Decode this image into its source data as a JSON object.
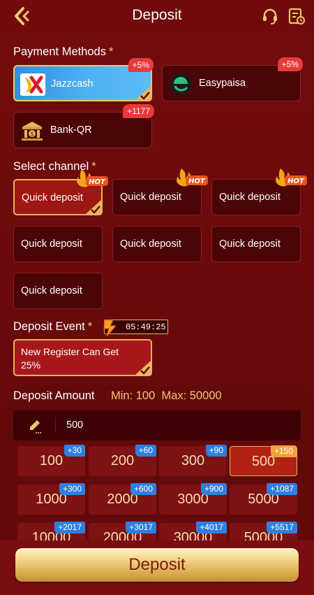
{
  "header": {
    "title": "Deposit",
    "back_icon": "back-arrow-icon",
    "support_icon": "headset-icon",
    "record_icon": "record-icon"
  },
  "colors": {
    "primary_bg": "#700a0c",
    "accent_gold": "#f1c86f",
    "badge_red": "#e83a3a",
    "badge_blue": "#2f7fe0",
    "badge_orange": "#f0a23a"
  },
  "payment": {
    "label": "Payment Methods",
    "required": "*",
    "methods": [
      {
        "name": "Jazzcash",
        "bonus": "+5%",
        "selected": true
      },
      {
        "name": "Easypaisa",
        "bonus": "+5%",
        "selected": false
      },
      {
        "name": "Bank-QR",
        "bonus": "+1177",
        "selected": false
      }
    ]
  },
  "channel": {
    "label": "Select channel",
    "required": "*",
    "hot": "HOT",
    "items": [
      {
        "name": "Quick deposit",
        "hot": true,
        "selected": true
      },
      {
        "name": "Quick deposit",
        "hot": true,
        "selected": false
      },
      {
        "name": "Quick deposit",
        "hot": true,
        "selected": false
      },
      {
        "name": "Quick deposit",
        "hot": false,
        "selected": false
      },
      {
        "name": "Quick deposit",
        "hot": false,
        "selected": false
      },
      {
        "name": "Quick deposit",
        "hot": false,
        "selected": false
      },
      {
        "name": "Quick deposit",
        "hot": false,
        "selected": false
      }
    ]
  },
  "event": {
    "label": "Deposit Event",
    "required": "*",
    "timer": "05:49:25",
    "card_text": "New Register Can Get 25%"
  },
  "amount": {
    "label": "Deposit Amount",
    "min_max": "Min: 100  Max: 50000",
    "input_value": "500",
    "options": [
      {
        "value": "100",
        "bonus": "+30"
      },
      {
        "value": "200",
        "bonus": "+60"
      },
      {
        "value": "300",
        "bonus": "+90"
      },
      {
        "value": "500",
        "bonus": "+150",
        "selected": true
      },
      {
        "value": "1000",
        "bonus": "+300"
      },
      {
        "value": "2000",
        "bonus": "+600"
      },
      {
        "value": "3000",
        "bonus": "+900"
      },
      {
        "value": "5000",
        "bonus": "+1087"
      },
      {
        "value": "10000",
        "bonus": "+2017"
      },
      {
        "value": "20000",
        "bonus": "+3017"
      },
      {
        "value": "30000",
        "bonus": "+4017"
      },
      {
        "value": "50000",
        "bonus": "+5517"
      }
    ]
  },
  "submit": {
    "label": "Deposit"
  }
}
